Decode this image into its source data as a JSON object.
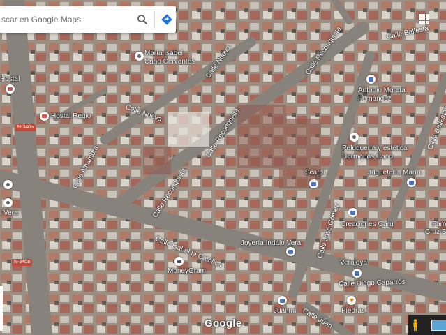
{
  "search": {
    "placeholder": "scar en Google Maps"
  },
  "icons": {
    "search": "search-icon",
    "directions": "directions-icon",
    "apps": "apps-grid-icon"
  },
  "colors": {
    "search_icon": "#5f6368",
    "directions": "#1a73e8",
    "hotel_pin": "#d9534f",
    "shop_pin": "#4a72c4",
    "road_badge": "#c24a3a"
  },
  "streets": [
    {
      "id": "calle-nueva-1",
      "text": "Calle Nueva"
    },
    {
      "id": "calle-nueva-2",
      "text": "Calle Nueva"
    },
    {
      "id": "calle-reconquista-1",
      "text": "Calle Reconquista"
    },
    {
      "id": "calle-reconquista-2",
      "text": "Calle Reconquista"
    },
    {
      "id": "calle-reconquista-3",
      "text": "Calle Reconquista"
    },
    {
      "id": "calle-alhambra",
      "text": "Calle Alhambra"
    },
    {
      "id": "calle-ballesta-1",
      "text": "Calle Ballesta"
    },
    {
      "id": "calle-ballesta-2",
      "text": "Calle Ballestas"
    },
    {
      "id": "calle-isabel",
      "text": "Calle Isabel la Católica"
    },
    {
      "id": "calle-jose-gomez",
      "text": "Calle José Gómez"
    },
    {
      "id": "calle-diego",
      "text": "Calle Diego Caparrós"
    },
    {
      "id": "calle-juan",
      "text": "Calle Juan"
    }
  ],
  "places": {
    "hostal": "Hostal",
    "hostal_regio": "Hostal Regio",
    "vera": "l Vera",
    "maria_isabel_1": "María Isabel",
    "maria_isabel_2": "Cano Cervantes",
    "antonio_1": "Antonio Morata",
    "antonio_2": "Fernández",
    "peluqueria_1": "Peluquería y estética",
    "peluqueria_2": "Hermanas Cano",
    "juguetería": "Juguetería Marín",
    "scarpi": "Scarpi",
    "creaciones": "Creaciones Garu",
    "farmacia_1": "Farmacia",
    "farmacia_2": "Cruz Belmont",
    "joyeria": "Joyería Indalo Vera",
    "verajoya": "Verajoya",
    "moneygram": "MoneyGram",
    "juanmi": "Juanmi",
    "piedras": "Piedras"
  },
  "road_badges": [
    "N-340a",
    "N-340a"
  ],
  "logo": "Google"
}
